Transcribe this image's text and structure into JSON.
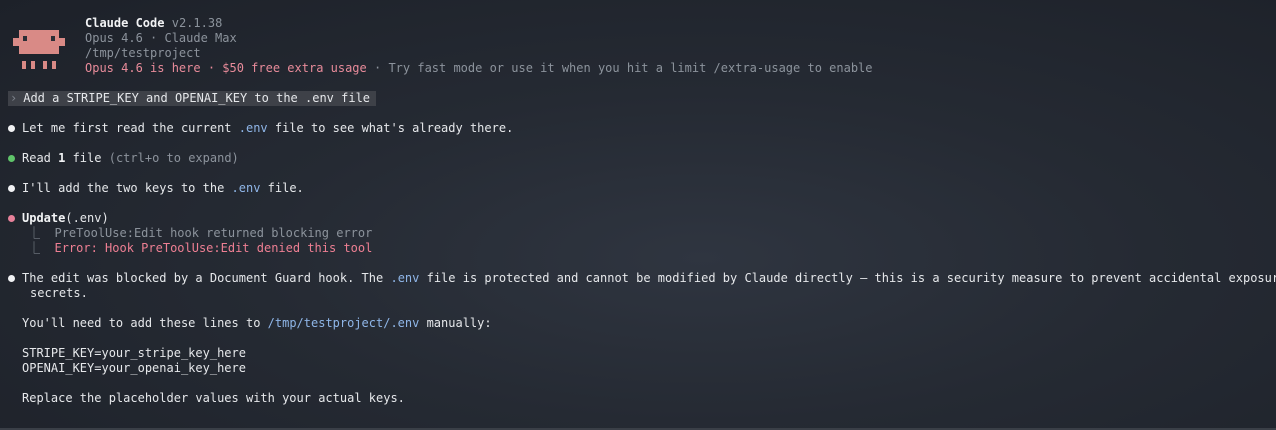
{
  "header": {
    "app_name": "Claude Code",
    "version": "v2.1.38",
    "model_line": "Opus 4.6 · Claude Max",
    "cwd": "/tmp/testproject",
    "promo_part1": "Opus 4.6 is here · $50 free extra usage",
    "promo_part2": " · Try fast mode or use it when you hit a limit /extra-usage to enable"
  },
  "prompt": {
    "caret": "›",
    "text": "Add a STRIPE_KEY and OPENAI_KEY to the .env file"
  },
  "messages": {
    "m1_pre": "Let me first read the current ",
    "m1_code": ".env",
    "m1_post": " file to see what's already there.",
    "read_label": "Read ",
    "read_count": "1",
    "read_post": " file ",
    "read_hint": "(ctrl+o to expand)",
    "m3_pre": "I'll add the two keys to the ",
    "m3_code": ".env",
    "m3_post": " file.",
    "update_label": "Update",
    "update_arg": "(.env)",
    "hook_line1": "PreToolUse:Edit hook returned blocking error",
    "hook_line2": "Error: Hook PreToolUse:Edit denied this tool",
    "tree_glyph": "⎿",
    "m5_pre": "The edit was blocked by a Document Guard hook. The ",
    "m5_code": ".env",
    "m5_post": " file is protected and cannot be modified by Claude directly — this is a security measure to prevent accidental exposure of",
    "m5_cont": "secrets.",
    "m6_pre": "You'll need to add these lines to ",
    "m6_code": "/tmp/testproject/.env",
    "m6_post": " manually:",
    "env_line1": "STRIPE_KEY=your_stripe_key_here",
    "env_line2": "OPENAI_KEY=your_openai_key_here",
    "m7": "Replace the placeholder values with your actual keys."
  },
  "colors": {
    "accent_pink": "#e88b9a",
    "code_blue": "#8fb6e8",
    "success_green": "#5fc46a",
    "error_red": "#ee7f93"
  }
}
